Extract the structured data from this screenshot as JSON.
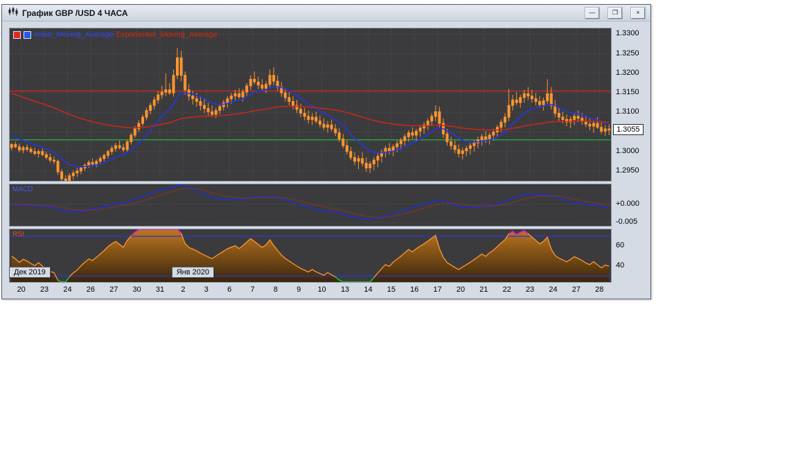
{
  "window": {
    "title": "График GBP /USD 4 ЧАСА",
    "controls": {
      "minimize": "—",
      "maximize": "❐",
      "close": "×"
    }
  },
  "legend": {
    "ma_fast_label": "ential_Moving_Average",
    "ma_slow_label": "Exponential_Moving_Average"
  },
  "colors": {
    "panel_bg": "#3b3b3d",
    "grid": "#5e5e62",
    "candle": "#ff9530",
    "window_bg": "#d4dbe5",
    "axis_text": "#000000"
  },
  "chart_data": {
    "type": "candlestick",
    "title": "GBP/USD 4-hour chart with EMA overlays, MACD and RSI",
    "symbol": "GBP/USD",
    "timeframe_label": "4 ЧАСА",
    "x_labels": [
      "20",
      "23",
      "24",
      "26",
      "27",
      "30",
      "31",
      "2",
      "3",
      "6",
      "7",
      "8",
      "9",
      "10",
      "13",
      "14",
      "15",
      "16",
      "17",
      "20",
      "21",
      "22",
      "23",
      "24",
      "27",
      "28"
    ],
    "candles_per_day": 6,
    "price_axis": {
      "min": 1.2925,
      "max": 1.3315,
      "grid_min": 1.295,
      "grid_max": 1.33,
      "grid_step": 0.005,
      "tick_labels": [
        "1.3300",
        "1.3250",
        "1.3200",
        "1.3150",
        "1.3100",
        "1.3000",
        "1.2950"
      ],
      "tick_values": [
        1.33,
        1.325,
        1.32,
        1.315,
        1.31,
        1.3,
        1.295
      ]
    },
    "current_price": {
      "text": "1.3055",
      "value": 1.3055
    },
    "hlines": [
      {
        "value": 1.3155,
        "color": "#e8281e"
      },
      {
        "value": 1.303,
        "color": "#1ec83c"
      }
    ],
    "overlays": [
      {
        "name": "ema-fast",
        "period": 12,
        "seed": 1.3045,
        "color": "#2336e8"
      },
      {
        "name": "ema-slow",
        "period": 80,
        "seed": 1.3152,
        "color": "#c62817"
      }
    ],
    "candles": [
      [
        1.301,
        1.3022,
        1.3002,
        1.3018
      ],
      [
        1.3018,
        1.3025,
        1.3008,
        1.3012
      ],
      [
        1.3012,
        1.302,
        1.2998,
        1.3004
      ],
      [
        1.3004,
        1.3015,
        1.2996,
        1.301
      ],
      [
        1.301,
        1.3018,
        1.3,
        1.3006
      ],
      [
        1.3006,
        1.3012,
        1.2995,
        1.3
      ],
      [
        1.3,
        1.301,
        1.299,
        1.2995
      ],
      [
        1.2995,
        1.3005,
        1.2985,
        1.3
      ],
      [
        1.3,
        1.3008,
        1.2988,
        1.2992
      ],
      [
        1.2992,
        1.3,
        1.298,
        1.2985
      ],
      [
        1.2985,
        1.2995,
        1.2972,
        1.2978
      ],
      [
        1.2978,
        1.2988,
        1.2968,
        1.2975
      ],
      [
        1.2975,
        1.298,
        1.294,
        1.2948
      ],
      [
        1.2948,
        1.2955,
        1.2905,
        1.293
      ],
      [
        1.293,
        1.294,
        1.29,
        1.2925
      ],
      [
        1.2925,
        1.2945,
        1.291,
        1.2938
      ],
      [
        1.2938,
        1.2952,
        1.2928,
        1.2945
      ],
      [
        1.2945,
        1.2958,
        1.2935,
        1.295
      ],
      [
        1.295,
        1.2962,
        1.2942,
        1.2958
      ],
      [
        1.2958,
        1.297,
        1.295,
        1.2965
      ],
      [
        1.2965,
        1.2978,
        1.2958,
        1.2972
      ],
      [
        1.2972,
        1.2982,
        1.2962,
        1.2968
      ],
      [
        1.2968,
        1.298,
        1.296,
        1.2975
      ],
      [
        1.2975,
        1.2988,
        1.2968,
        1.2982
      ],
      [
        1.2982,
        1.2995,
        1.2975,
        1.299
      ],
      [
        1.299,
        1.3005,
        1.2982,
        1.3
      ],
      [
        1.3,
        1.3015,
        1.2992,
        1.3008
      ],
      [
        1.3008,
        1.3022,
        1.3,
        1.3015
      ],
      [
        1.3015,
        1.3028,
        1.3005,
        1.301
      ],
      [
        1.301,
        1.302,
        1.2998,
        1.3005
      ],
      [
        1.3005,
        1.303,
        1.3,
        1.3025
      ],
      [
        1.3025,
        1.3048,
        1.3018,
        1.3042
      ],
      [
        1.3042,
        1.3065,
        1.3035,
        1.3058
      ],
      [
        1.3058,
        1.308,
        1.305,
        1.3072
      ],
      [
        1.3072,
        1.3095,
        1.3065,
        1.3088
      ],
      [
        1.3088,
        1.3112,
        1.308,
        1.3105
      ],
      [
        1.3105,
        1.3125,
        1.3095,
        1.3118
      ],
      [
        1.3118,
        1.314,
        1.3108,
        1.3132
      ],
      [
        1.3132,
        1.3155,
        1.3122,
        1.3145
      ],
      [
        1.3145,
        1.3168,
        1.3135,
        1.3152
      ],
      [
        1.3152,
        1.32,
        1.3142,
        1.3158
      ],
      [
        1.3158,
        1.3175,
        1.3145,
        1.315
      ],
      [
        1.315,
        1.321,
        1.314,
        1.3195
      ],
      [
        1.3195,
        1.3265,
        1.3185,
        1.324
      ],
      [
        1.324,
        1.3258,
        1.318,
        1.3195
      ],
      [
        1.3195,
        1.3205,
        1.3145,
        1.3158
      ],
      [
        1.3158,
        1.3172,
        1.313,
        1.3142
      ],
      [
        1.3142,
        1.3155,
        1.312,
        1.3135
      ],
      [
        1.3135,
        1.315,
        1.3115,
        1.3128
      ],
      [
        1.3128,
        1.3142,
        1.3105,
        1.3118
      ],
      [
        1.3118,
        1.3135,
        1.3098,
        1.311
      ],
      [
        1.311,
        1.3125,
        1.3092,
        1.3102
      ],
      [
        1.3102,
        1.3118,
        1.3088,
        1.3095
      ],
      [
        1.3095,
        1.3112,
        1.3085,
        1.3105
      ],
      [
        1.3105,
        1.3122,
        1.3095,
        1.3115
      ],
      [
        1.3115,
        1.3132,
        1.3105,
        1.3125
      ],
      [
        1.3125,
        1.3142,
        1.3112,
        1.3135
      ],
      [
        1.3135,
        1.315,
        1.3122,
        1.3142
      ],
      [
        1.3142,
        1.3158,
        1.313,
        1.3148
      ],
      [
        1.3148,
        1.3162,
        1.3135,
        1.314
      ],
      [
        1.314,
        1.316,
        1.3128,
        1.3152
      ],
      [
        1.3152,
        1.3175,
        1.3142,
        1.3168
      ],
      [
        1.3168,
        1.3195,
        1.3158,
        1.3185
      ],
      [
        1.3185,
        1.3205,
        1.3172,
        1.3178
      ],
      [
        1.3178,
        1.3192,
        1.316,
        1.317
      ],
      [
        1.317,
        1.3185,
        1.3155,
        1.3162
      ],
      [
        1.3162,
        1.318,
        1.315,
        1.3172
      ],
      [
        1.3172,
        1.321,
        1.3162,
        1.3195
      ],
      [
        1.3195,
        1.3215,
        1.317,
        1.318
      ],
      [
        1.318,
        1.3195,
        1.3155,
        1.3165
      ],
      [
        1.3165,
        1.3178,
        1.314,
        1.315
      ],
      [
        1.315,
        1.3162,
        1.3128,
        1.3138
      ],
      [
        1.3138,
        1.3152,
        1.3118,
        1.3128
      ],
      [
        1.3128,
        1.3142,
        1.3108,
        1.3118
      ],
      [
        1.3118,
        1.3132,
        1.3098,
        1.3108
      ],
      [
        1.3108,
        1.3122,
        1.3088,
        1.3098
      ],
      [
        1.3098,
        1.3112,
        1.308,
        1.309
      ],
      [
        1.309,
        1.3105,
        1.3072,
        1.3082
      ],
      [
        1.3082,
        1.3098,
        1.3068,
        1.3088
      ],
      [
        1.3088,
        1.3102,
        1.3072,
        1.3078
      ],
      [
        1.3078,
        1.3092,
        1.3062,
        1.307
      ],
      [
        1.307,
        1.3085,
        1.3055,
        1.3062
      ],
      [
        1.3062,
        1.3078,
        1.3048,
        1.3068
      ],
      [
        1.3068,
        1.3082,
        1.3052,
        1.3058
      ],
      [
        1.3058,
        1.307,
        1.304,
        1.3048
      ],
      [
        1.3048,
        1.306,
        1.3025,
        1.3032
      ],
      [
        1.3032,
        1.3045,
        1.3008,
        1.3015
      ],
      [
        1.3015,
        1.3028,
        1.2992,
        1.3
      ],
      [
        1.3,
        1.3012,
        1.2978,
        1.2985
      ],
      [
        1.2985,
        1.2998,
        1.2965,
        1.2975
      ],
      [
        1.2975,
        1.299,
        1.2955,
        1.2982
      ],
      [
        1.2982,
        1.2998,
        1.2962,
        1.297
      ],
      [
        1.297,
        1.2985,
        1.2948,
        1.2958
      ],
      [
        1.2958,
        1.2975,
        1.2945,
        1.2968
      ],
      [
        1.2968,
        1.2985,
        1.2952,
        1.2978
      ],
      [
        1.2978,
        1.2995,
        1.296,
        1.2988
      ],
      [
        1.2988,
        1.3005,
        1.2972,
        1.2998
      ],
      [
        1.2998,
        1.3015,
        1.2985,
        1.3008
      ],
      [
        1.3008,
        1.3022,
        1.2992,
        1.3002
      ],
      [
        1.3002,
        1.3018,
        1.2988,
        1.3012
      ],
      [
        1.3012,
        1.3028,
        1.2998,
        1.302
      ],
      [
        1.302,
        1.3035,
        1.3005,
        1.3028
      ],
      [
        1.3028,
        1.3045,
        1.3015,
        1.3038
      ],
      [
        1.3038,
        1.3055,
        1.3025,
        1.3048
      ],
      [
        1.3048,
        1.3062,
        1.3032,
        1.3042
      ],
      [
        1.3042,
        1.3058,
        1.3028,
        1.3052
      ],
      [
        1.3052,
        1.3068,
        1.3038,
        1.306
      ],
      [
        1.306,
        1.3075,
        1.3045,
        1.3068
      ],
      [
        1.3068,
        1.3085,
        1.3055,
        1.3078
      ],
      [
        1.3078,
        1.3098,
        1.3065,
        1.309
      ],
      [
        1.309,
        1.3118,
        1.3078,
        1.3102
      ],
      [
        1.3102,
        1.3115,
        1.3062,
        1.3072
      ],
      [
        1.3072,
        1.3085,
        1.3035,
        1.3045
      ],
      [
        1.3045,
        1.3058,
        1.3015,
        1.3025
      ],
      [
        1.3025,
        1.3038,
        1.3005,
        1.3015
      ],
      [
        1.3015,
        1.3028,
        1.2995,
        1.3005
      ],
      [
        1.3005,
        1.3018,
        1.2985,
        1.2995
      ],
      [
        1.2995,
        1.301,
        1.298,
        1.3002
      ],
      [
        1.3002,
        1.3015,
        1.2988,
        1.3008
      ],
      [
        1.3008,
        1.3022,
        1.2992,
        1.3015
      ],
      [
        1.3015,
        1.303,
        1.3,
        1.3022
      ],
      [
        1.3022,
        1.3038,
        1.3008,
        1.303
      ],
      [
        1.303,
        1.3045,
        1.3015,
        1.3038
      ],
      [
        1.3038,
        1.3052,
        1.3022,
        1.3032
      ],
      [
        1.3032,
        1.3048,
        1.3018,
        1.3042
      ],
      [
        1.3042,
        1.3058,
        1.3028,
        1.305
      ],
      [
        1.305,
        1.3068,
        1.3038,
        1.3062
      ],
      [
        1.3062,
        1.3082,
        1.305,
        1.3075
      ],
      [
        1.3075,
        1.3098,
        1.3062,
        1.3088
      ],
      [
        1.3088,
        1.316,
        1.3078,
        1.3118
      ],
      [
        1.3118,
        1.3145,
        1.3105,
        1.3132
      ],
      [
        1.3132,
        1.3152,
        1.3118,
        1.3125
      ],
      [
        1.3125,
        1.3145,
        1.3112,
        1.3138
      ],
      [
        1.3138,
        1.3158,
        1.3125,
        1.3148
      ],
      [
        1.3148,
        1.3165,
        1.3132,
        1.3142
      ],
      [
        1.3142,
        1.3158,
        1.3125,
        1.3135
      ],
      [
        1.3135,
        1.315,
        1.3118,
        1.3128
      ],
      [
        1.3128,
        1.3142,
        1.3112,
        1.312
      ],
      [
        1.312,
        1.3138,
        1.3105,
        1.313
      ],
      [
        1.313,
        1.3185,
        1.312,
        1.3148
      ],
      [
        1.3148,
        1.3165,
        1.3108,
        1.3118
      ],
      [
        1.3118,
        1.3132,
        1.3088,
        1.3098
      ],
      [
        1.3098,
        1.3112,
        1.3078,
        1.3088
      ],
      [
        1.3088,
        1.3102,
        1.3072,
        1.3082
      ],
      [
        1.3082,
        1.3095,
        1.3065,
        1.3075
      ],
      [
        1.3075,
        1.309,
        1.306,
        1.3082
      ],
      [
        1.3082,
        1.3098,
        1.3068,
        1.309
      ],
      [
        1.309,
        1.3105,
        1.3075,
        1.3085
      ],
      [
        1.3085,
        1.3098,
        1.3068,
        1.3078
      ],
      [
        1.3078,
        1.3092,
        1.3062,
        1.307
      ],
      [
        1.307,
        1.3085,
        1.3055,
        1.3065
      ],
      [
        1.3065,
        1.308,
        1.3048,
        1.3072
      ],
      [
        1.3072,
        1.3088,
        1.3058,
        1.3062
      ],
      [
        1.3062,
        1.3075,
        1.3045,
        1.3052
      ],
      [
        1.3052,
        1.3068,
        1.304,
        1.3058
      ],
      [
        1.3058,
        1.307,
        1.3042,
        1.3055
      ]
    ],
    "indicators": {
      "macd": {
        "label": "MACD",
        "fast": 12,
        "slow": 26,
        "signal": 9,
        "range_top": 0.0055,
        "range_bottom": -0.0059,
        "axis_labels": [
          {
            "text": "+0.000",
            "value": 0
          },
          {
            "text": "-0.005",
            "value": -0.005
          }
        ],
        "line_color": "#1b2ed8",
        "signal_color": "#d42814"
      },
      "rsi": {
        "label": "RSI",
        "period": 14,
        "range_top": 77,
        "range_bottom": 24,
        "levels": [
          70,
          30
        ],
        "axis_labels": [
          {
            "text": "60",
            "value": 60
          },
          {
            "text": "40",
            "value": 40
          }
        ],
        "line_color": "#ff9530",
        "level_color": "#2636d8",
        "overbought_color": "#e020c0",
        "oversold_color": "#18b428"
      }
    },
    "period_markers": [
      {
        "label": "Дек 2019",
        "day_index": 0
      },
      {
        "label": "Янв 2020",
        "day_index": 7
      }
    ]
  }
}
